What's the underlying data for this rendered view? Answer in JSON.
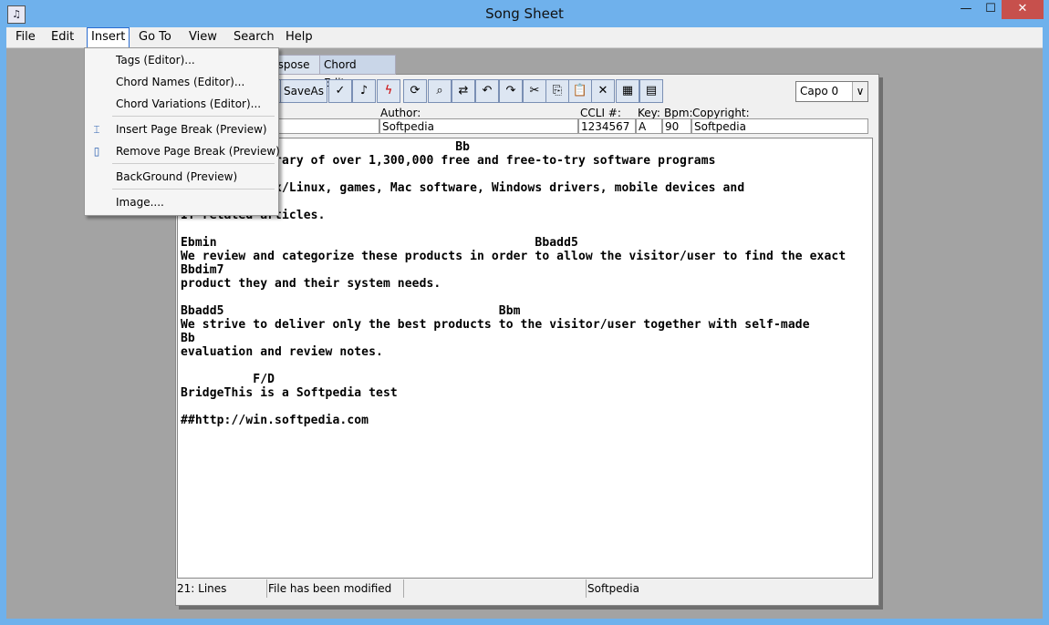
{
  "window": {
    "title": "Song Sheet",
    "min_glyph": "—",
    "max_glyph": "☐",
    "close_glyph": "✕",
    "app_icon_glyph": "♫"
  },
  "menubar": [
    "File",
    "Edit",
    "Insert",
    "Go To",
    "View",
    "Search",
    "Help"
  ],
  "tabs": [
    "nspose",
    "Chord Editor"
  ],
  "toolbar": {
    "saveas_label": "SaveAs"
  },
  "capo": {
    "value": "Capo 0",
    "arrow": "∨"
  },
  "fields": {
    "author_label": "Author:",
    "author_value": "Softpedia",
    "ccli_label": "CCLI #:",
    "ccli_value": "1234567",
    "key_label": "Key:",
    "key_value": "A",
    "bpm_label": "Bpm:",
    "bpm_value": "90",
    "copyright_label": "Copyright:",
    "copyright_value": "Softpedia"
  },
  "editor_lines": [
    "                                      Bb",
    "        a library of over 1,300,000 free and free-to-try software programs",
    "",
    "       nd Unix/Linux, games, Mac software, Windows drivers, mobile devices and",
    "",
    "IT-related articles.",
    "",
    "Ebmin                                            Bbadd5",
    "We review and categorize these products in order to allow the visitor/user to find the exact",
    "Bbdim7",
    "product they and their system needs.",
    "",
    "Bbadd5                                      Bbm",
    "We strive to deliver only the best products to the visitor/user together with self-made",
    "Bb",
    "evaluation and review notes.",
    "",
    "          F/D",
    "BridgeThis is a Softpedia test",
    "",
    "##http://win.softpedia.com"
  ],
  "status": {
    "lines": "21: Lines",
    "modified": "File has been modified",
    "author": "Softpedia"
  },
  "insert_menu": {
    "items": [
      "Tags (Editor)...",
      "Chord Names (Editor)...",
      "Chord Variations (Editor)...",
      "Insert Page Break (Preview)",
      "Remove Page Break (Preview)",
      "BackGround (Preview)",
      "Image...."
    ]
  }
}
